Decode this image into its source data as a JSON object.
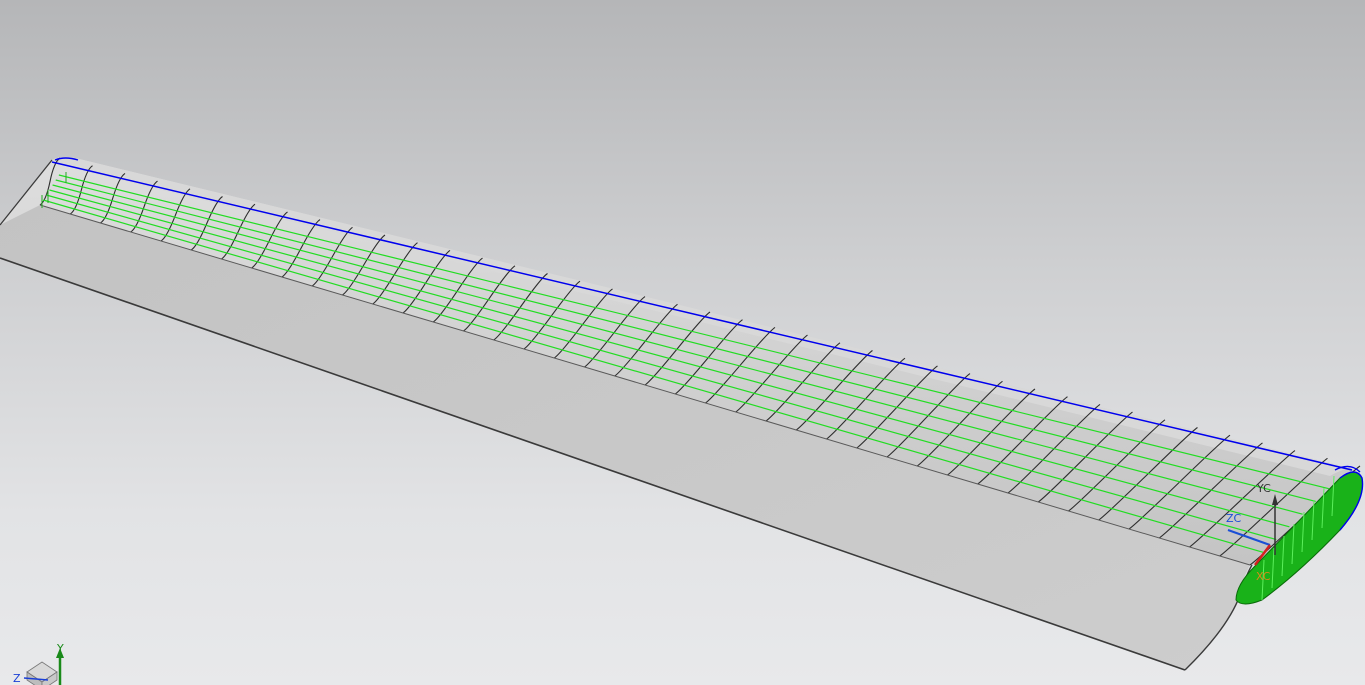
{
  "viewport": {
    "background_top": "#b5b6b8",
    "background_bottom": "#e8e9eb"
  },
  "model": {
    "surface_color": "#c9c9c9",
    "edge_color": "#3a3a3a",
    "rib_color": "#2e2e2e",
    "mesh_color": "#22dd22",
    "spar_color": "#0000ee",
    "end_cap_color": "#19b219",
    "rib_count": 40,
    "mesh_line_count": 6
  },
  "wcs": {
    "y_label": "YC",
    "z_label": "ZC",
    "x_label": "XC",
    "y_color": "#333333",
    "z_color": "#1a4fd6",
    "x_color": "#d62020"
  },
  "triad": {
    "y_label": "Y",
    "z_label": "Z",
    "y_color": "#1a8a1a",
    "z_color": "#1a3fd6",
    "cube_icon": "view-cube-icon"
  }
}
